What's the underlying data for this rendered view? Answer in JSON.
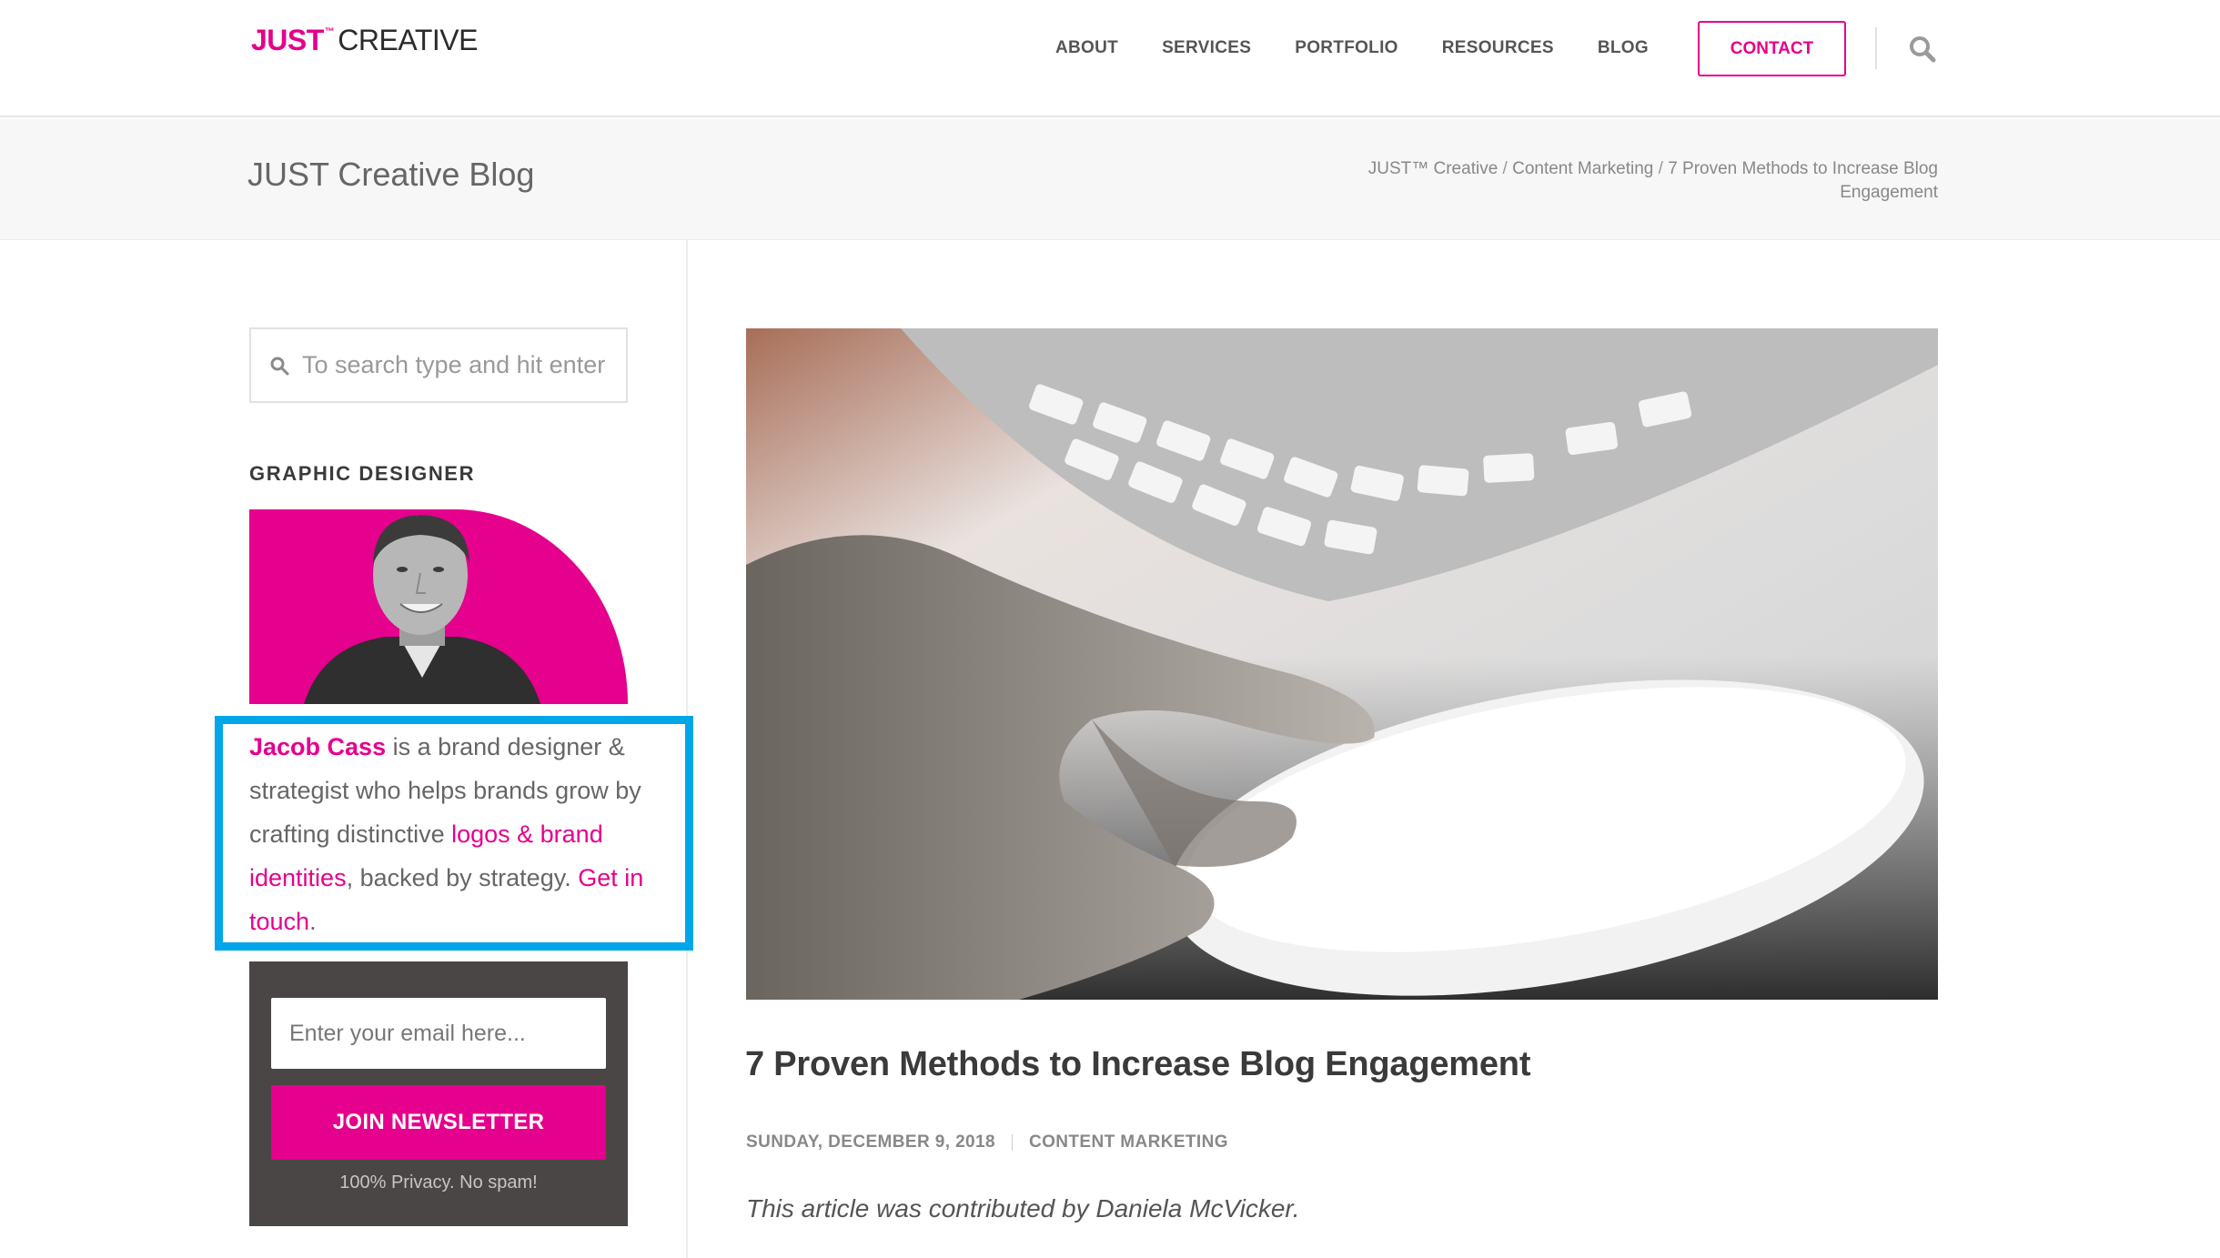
{
  "brand": {
    "logo_bold": "JUST",
    "logo_tm": "™",
    "logo_rest": "CREATIVE",
    "accent_color": "#e5008d"
  },
  "nav": {
    "items": [
      "ABOUT",
      "SERVICES",
      "PORTFOLIO",
      "RESOURCES",
      "BLOG"
    ],
    "contact_label": "CONTACT",
    "search_icon": "search-icon"
  },
  "titlebar": {
    "title": "JUST Creative Blog",
    "breadcrumb": {
      "home": "JUST™ Creative",
      "category": "Content Marketing",
      "current": "7 Proven Methods to Increase Blog Engagement",
      "separator": "/"
    }
  },
  "sidebar": {
    "search": {
      "placeholder": "To search type and hit enter"
    },
    "widget_title": "GRAPHIC DESIGNER",
    "bio": {
      "name": "Jacob Cass",
      "text_1": " is a brand designer & strategist who helps brands grow by crafting distinctive ",
      "link_logos": "logos & brand identities",
      "text_2": ", backed by strategy. ",
      "link_contact": "Get in touch",
      "text_3": "."
    },
    "newsletter": {
      "email_placeholder": "Enter your email here...",
      "button_label": "JOIN NEWSLETTER",
      "privacy": "100% Privacy. No spam!"
    }
  },
  "post": {
    "title": "7 Proven Methods to Increase Blog Engagement",
    "date": "SUNDAY, DECEMBER 9, 2018",
    "category": "CONTENT MARKETING",
    "intro": "This article was contributed by Daniela McVicker."
  }
}
